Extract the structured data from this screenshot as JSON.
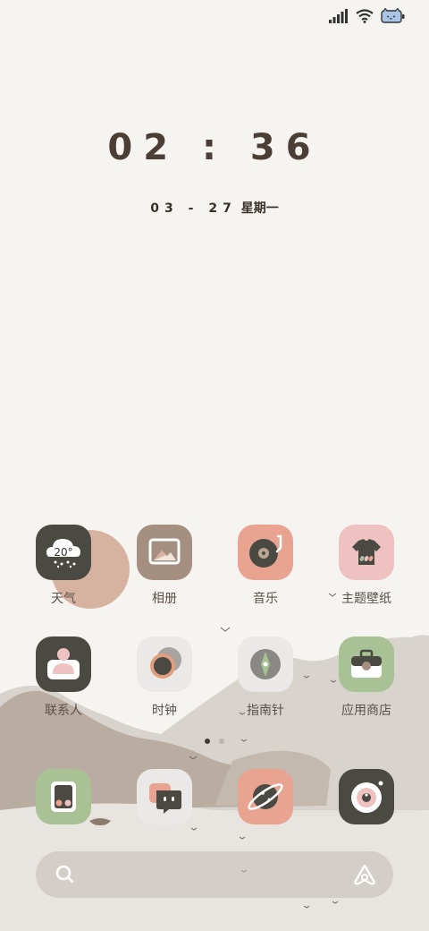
{
  "status_bar": {
    "signal_icon": "signal-bars-icon",
    "wifi_icon": "wifi-icon",
    "battery_icon": "battery-cat-icon"
  },
  "lockclock": {
    "time": "02 : 36",
    "date": "03 - 27",
    "weekday": "星期一"
  },
  "weather_widget": {
    "temp": "20°"
  },
  "apps_row1": [
    {
      "label": "天气",
      "icon": "weather-cloud-icon"
    },
    {
      "label": "相册",
      "icon": "gallery-picture-icon"
    },
    {
      "label": "音乐",
      "icon": "music-record-icon"
    },
    {
      "label": "主题壁纸",
      "icon": "theme-shirt-icon"
    }
  ],
  "apps_row2": [
    {
      "label": "联系人",
      "icon": "contacts-person-icon"
    },
    {
      "label": "时钟",
      "icon": "clock-circles-icon"
    },
    {
      "label": "指南针",
      "icon": "compass-needle-icon"
    },
    {
      "label": "应用商店",
      "icon": "app-store-bag-icon"
    }
  ],
  "dock": [
    {
      "icon": "phone-dual-icon"
    },
    {
      "icon": "messages-bubble-icon"
    },
    {
      "icon": "browser-planet-icon"
    },
    {
      "icon": "camera-lens-icon"
    }
  ],
  "page_indicator": {
    "pages": 2,
    "active": 1
  },
  "search": {
    "icon": "search-icon",
    "assistant_icon": "assistant-icon"
  },
  "colors": {
    "background": "#f6f4f0",
    "dark_icon": "#4a4a43",
    "salmon": "#e8a391",
    "pink": "#efc2c2",
    "green": "#a8c195",
    "taupe": "#a58f80"
  }
}
